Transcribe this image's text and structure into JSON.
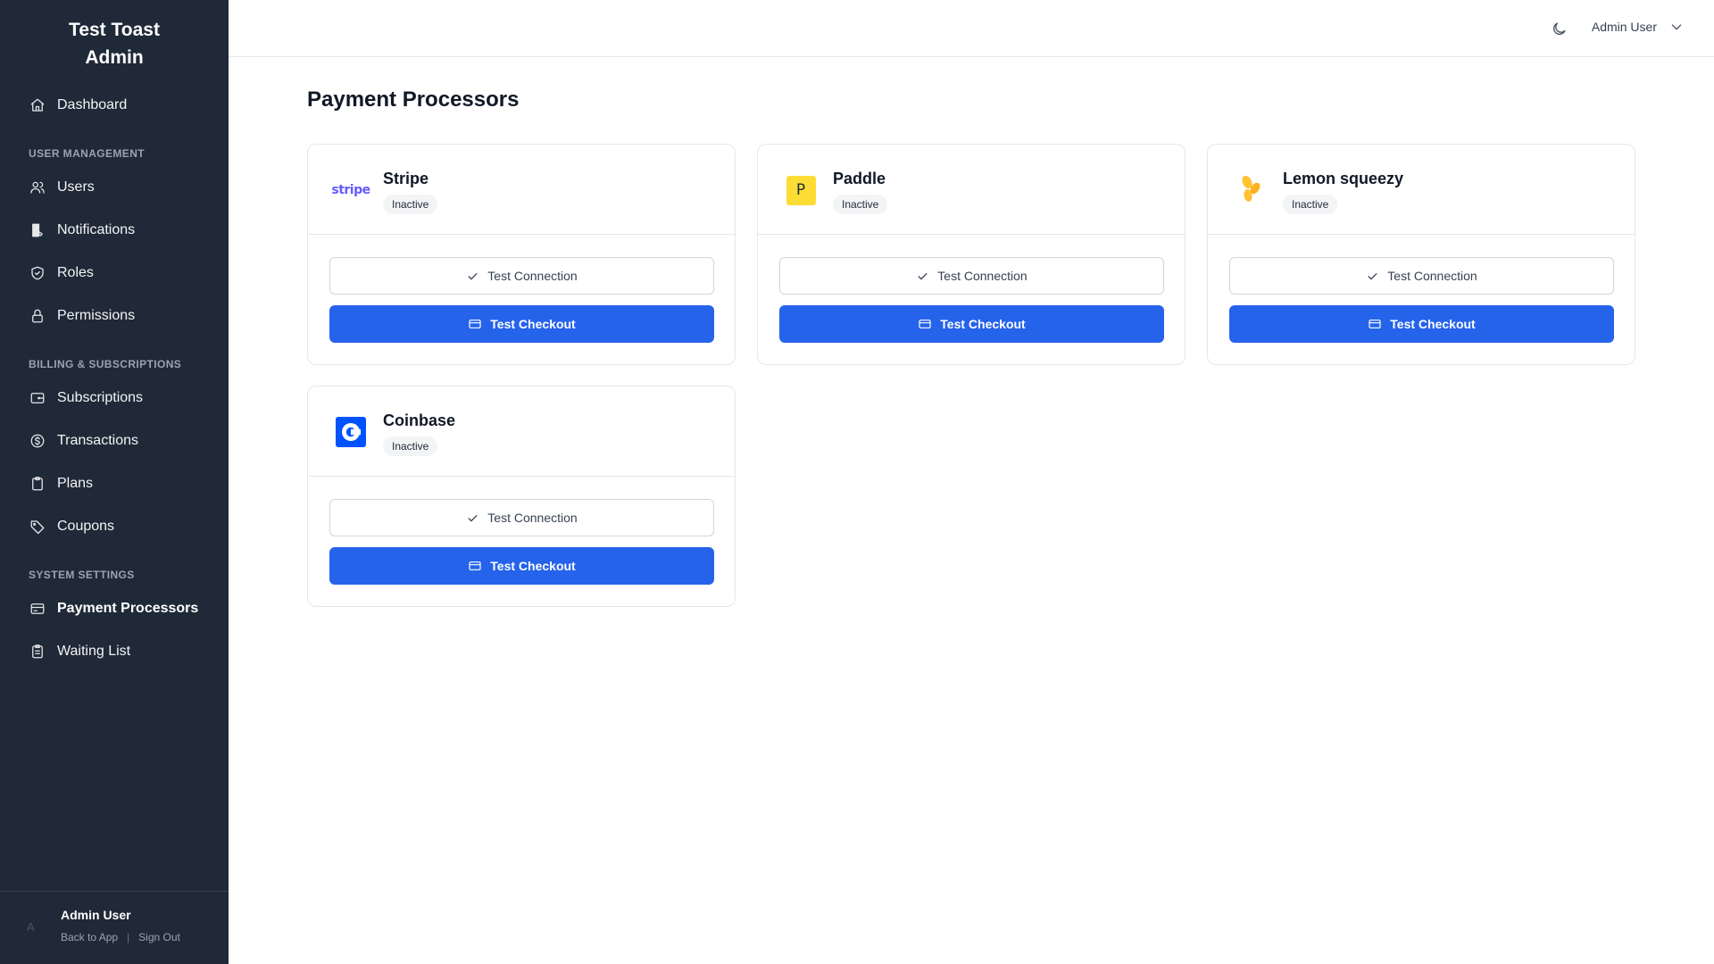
{
  "sidebar": {
    "brand_line1": "Test Toast",
    "brand_line2": "Admin",
    "dashboard": {
      "label": "Dashboard",
      "icon": "home-icon"
    },
    "sections": [
      {
        "title": "USER MANAGEMENT",
        "items": [
          {
            "label": "Users",
            "icon": "users-icon"
          },
          {
            "label": "Notifications",
            "icon": "notification-icon"
          },
          {
            "label": "Roles",
            "icon": "shield-icon"
          },
          {
            "label": "Permissions",
            "icon": "lock-icon"
          }
        ]
      },
      {
        "title": "BILLING & SUBSCRIPTIONS",
        "items": [
          {
            "label": "Subscriptions",
            "icon": "subscription-icon"
          },
          {
            "label": "Transactions",
            "icon": "dollar-icon"
          },
          {
            "label": "Plans",
            "icon": "clipboard-icon"
          },
          {
            "label": "Coupons",
            "icon": "tag-icon"
          }
        ]
      },
      {
        "title": "SYSTEM SETTINGS",
        "items": [
          {
            "label": "Payment Processors",
            "icon": "credit-card-icon",
            "active": true
          },
          {
            "label": "Waiting List",
            "icon": "list-clipboard-icon"
          }
        ]
      }
    ],
    "footer": {
      "avatar_initial": "A",
      "name": "Admin User",
      "back_link": "Back to App",
      "separator": "|",
      "sign_out": "Sign Out"
    }
  },
  "header": {
    "theme_icon": "moon-icon",
    "user_name": "Admin User",
    "dropdown_icon": "chevron-down-icon"
  },
  "main": {
    "title": "Payment Processors",
    "processors": [
      {
        "name": "Stripe",
        "status": "Inactive",
        "logo": "stripe-logo",
        "logo_text": "stripe",
        "test_connection": "Test Connection",
        "test_checkout": "Test Checkout"
      },
      {
        "name": "Paddle",
        "status": "Inactive",
        "logo": "paddle-logo",
        "logo_text": "P",
        "test_connection": "Test Connection",
        "test_checkout": "Test Checkout"
      },
      {
        "name": "Lemon squeezy",
        "status": "Inactive",
        "logo": "lemon-squeezy-logo",
        "test_connection": "Test Connection",
        "test_checkout": "Test Checkout"
      },
      {
        "name": "Coinbase",
        "status": "Inactive",
        "logo": "coinbase-logo",
        "test_connection": "Test Connection",
        "test_checkout": "Test Checkout"
      }
    ]
  },
  "colors": {
    "sidebar_bg": "#1f2937",
    "primary": "#2563eb",
    "stripe": "#635bff",
    "paddle": "#fddd35",
    "lemon": "#ffc233",
    "coinbase": "#0052ff"
  }
}
